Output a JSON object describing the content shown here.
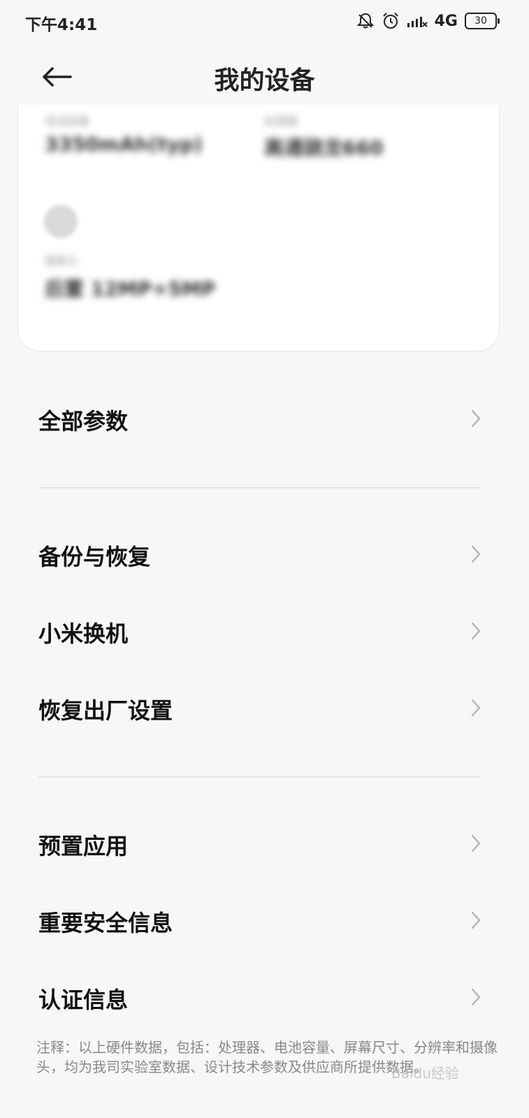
{
  "status_bar": {
    "time": "下午4:41",
    "network": "4G",
    "battery": "30",
    "icons": [
      "bell-off-icon",
      "alarm-icon",
      "signal-icon",
      "battery-icon"
    ]
  },
  "header": {
    "title": "我的设备",
    "back_icon": "arrow-left-icon"
  },
  "spec_card": {
    "battery_label": "电池容量",
    "battery_value": "3350mAh(typ)",
    "cpu_label": "处理器",
    "cpu_value": "高通骁龙660",
    "camera_label": "摄像头",
    "camera_value": "后置 12MP+5MP"
  },
  "menu": {
    "section1": [
      {
        "label": "全部参数"
      }
    ],
    "section2": [
      {
        "label": "备份与恢复"
      },
      {
        "label": "小米换机"
      },
      {
        "label": "恢复出厂设置"
      }
    ],
    "section3": [
      {
        "label": "预置应用"
      },
      {
        "label": "重要安全信息"
      },
      {
        "label": "认证信息"
      }
    ]
  },
  "footnote": "注释：以上硬件数据，包括：处理器、电池容量、屏幕尺寸、分辨率和摄像头，均为我司实验室数据、设计技术参数及供应商所提供数据。",
  "watermark": "Baidu经验"
}
